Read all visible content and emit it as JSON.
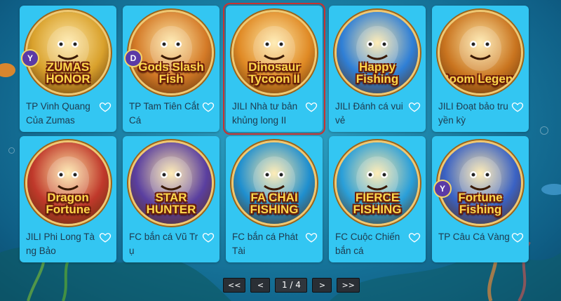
{
  "games": [
    {
      "title": "TP Vinh Quang Của Zumas",
      "logo": "ZUMAS HONOR",
      "badge": "Y",
      "art": "totem-mask-icon",
      "bg": "#d9a12c"
    },
    {
      "title": "TP Tam Tiên Cắt Cá",
      "logo": "Gods Slash Fish",
      "badge": "D",
      "art": "god-of-wealth-icon",
      "bg": "#d47a27"
    },
    {
      "title": "JILI Nhà tư bản khủng long II",
      "logo": "Dinosaur Tycoon II",
      "badge": "",
      "art": "dinosaur-icon",
      "bg": "#e08a25",
      "selected": true
    },
    {
      "title": "JILI Đánh cá vui vẻ",
      "logo": "Happy Fishing",
      "badge": "",
      "art": "shark-icon",
      "bg": "#2f7fd6"
    },
    {
      "title": "JILI Đoạt bảo tru yền kỳ",
      "logo": "Boom Legend",
      "badge": "",
      "art": "pirate-king-icon",
      "bg": "#c9741f"
    },
    {
      "title": "JILI Phi Long Tà ng Bảo",
      "logo": "Dragon Fortune",
      "badge": "",
      "art": "red-dragon-icon",
      "bg": "#c0392b"
    },
    {
      "title": "FC bắn cá Vũ Tr ụ",
      "logo": "STAR HUNTER",
      "badge": "",
      "art": "robot-icon",
      "bg": "#5a3fa0"
    },
    {
      "title": "FC bắn cá Phát Tài",
      "logo": "FA CHAI FISHING",
      "badge": "",
      "art": "golden-dragon-icon",
      "bg": "#1f8fcf"
    },
    {
      "title": "FC Cuộc Chiến bắn cá",
      "logo": "FIERCE FISHING",
      "badge": "",
      "art": "octopus-icon",
      "bg": "#2a9fd9"
    },
    {
      "title": "TP Câu Cá Vàng",
      "logo": "Fortune Fishing",
      "badge": "Y",
      "art": "fortune-god-icon",
      "bg": "#3a62c4"
    }
  ],
  "pager": {
    "first": "<<",
    "prev": "<",
    "info": "1 / 4",
    "next": ">",
    "last": ">>"
  },
  "colors": {
    "card": "#33c6f2",
    "selected_border": "#c9322f",
    "title_text": "#1d3a4e"
  }
}
